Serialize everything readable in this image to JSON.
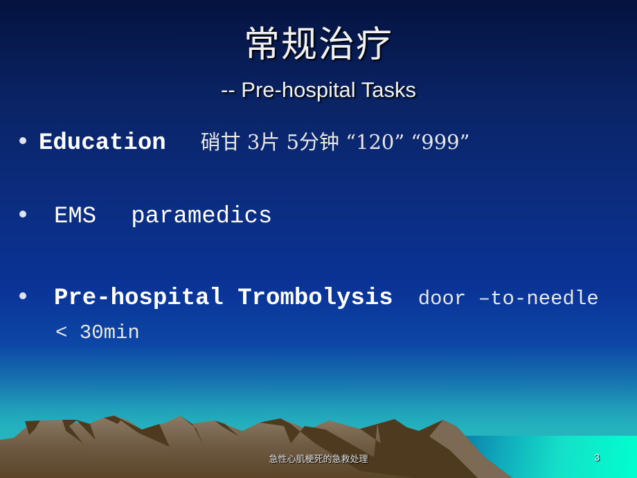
{
  "slide": {
    "title": "常规治疗",
    "subtitle": "-- Pre-hospital Tasks",
    "bullets": [
      {
        "term": "Education",
        "detail": "硝甘 3片 5分钟 “120” “999”"
      },
      {
        "term": "EMS",
        "detail": "paramedics"
      },
      {
        "term": "Pre-hospital Trombolysis",
        "detail": "door –to-needle",
        "continuation": "< 30min"
      }
    ],
    "footer": "急性心肌梗死的急救处理",
    "page_number": "3"
  },
  "icons": {
    "bullet": "bullet-dot-icon",
    "scenery": "mountain-landscape"
  },
  "colors": {
    "background_top": "#04133f",
    "background_mid": "#0b2e84",
    "background_bottom": "#27b8c0",
    "mountain_light": "#7a6650",
    "mountain_dark": "#4e3a1e",
    "sea": "#00ffd0",
    "text": "#ffffff"
  }
}
